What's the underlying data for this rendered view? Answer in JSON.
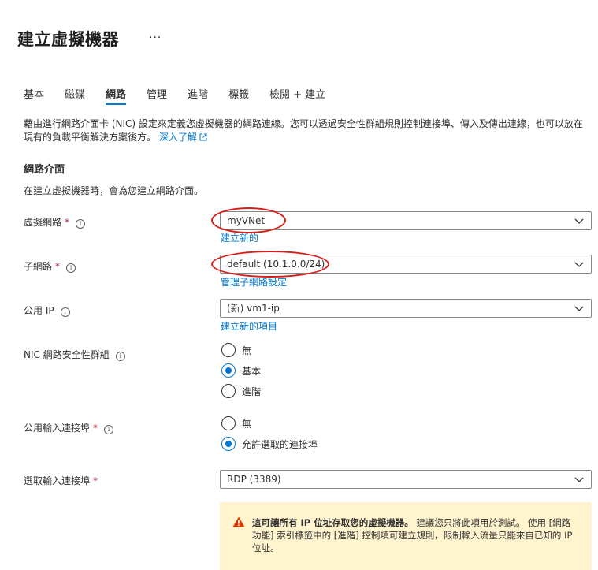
{
  "header": {
    "title": "建立虛擬機器",
    "more": "···"
  },
  "tabs": [
    {
      "label": "基本",
      "active": false
    },
    {
      "label": "磁碟",
      "active": false
    },
    {
      "label": "網路",
      "active": true
    },
    {
      "label": "管理",
      "active": false
    },
    {
      "label": "進階",
      "active": false
    },
    {
      "label": "標籤",
      "active": false
    },
    {
      "label": "檢閱 + 建立",
      "active": false
    }
  ],
  "description": {
    "text": "藉由進行網路介面卡 (NIC) 設定來定義您虛擬機器的網路連線。您可以透過安全性群組規則控制連接埠、傳入及傳出連線，也可以放在現有的負載平衡解決方案後方。",
    "learn_more": "深入了解"
  },
  "network_interface": {
    "title": "網路介面",
    "subtitle": "在建立虛擬機器時，會為您建立網路介面。",
    "vnet": {
      "label": "虛擬網路",
      "required": "*",
      "value": "myVNet",
      "link": "建立新的"
    },
    "subnet": {
      "label": "子網路",
      "required": "*",
      "value": "default (10.1.0.0/24)",
      "link": "管理子網路設定"
    },
    "public_ip": {
      "label": "公用 IP",
      "value": "(新) vm1-ip",
      "link": "建立新的項目"
    },
    "nsg": {
      "label": "NIC 網路安全性群組",
      "options": [
        "無",
        "基本",
        "進階"
      ],
      "selected": "基本"
    },
    "public_ports": {
      "label": "公用輸入連接埠",
      "required": "*",
      "options": [
        "無",
        "允許選取的連接埠"
      ],
      "selected": "允許選取的連接埠"
    },
    "inbound_ports": {
      "label": "選取輸入連接埠",
      "required": "*",
      "value": "RDP (3389)"
    }
  },
  "warning": {
    "bold": "這可讓所有 IP 位址存取您的虛擬機器。",
    "text": " 建議您只將此項用於測試。 使用 [網路功能] 索引標籤中的 [進階] 控制項可建立規則，限制輸入流量只能來自已知的 IP 位址。"
  },
  "colors": {
    "accent": "#0078d4",
    "required": "#a4262c",
    "warning_bg": "#fff4ce",
    "warning_icon": "#d83b01",
    "annotation": "#d91e18"
  }
}
